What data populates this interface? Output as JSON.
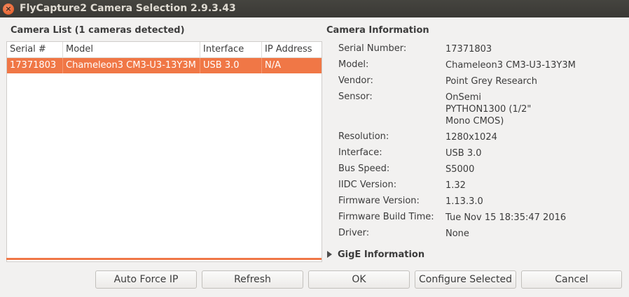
{
  "window": {
    "title": "FlyCapture2 Camera Selection 2.9.3.43",
    "close_glyph": "×"
  },
  "camera_list": {
    "heading": "Camera List   (1 cameras detected)",
    "columns": [
      "Serial #",
      "Model",
      "Interface",
      "IP Address"
    ],
    "rows": [
      [
        "17371803",
        "Chameleon3 CM3-U3-13Y3M",
        "USB 3.0",
        "N/A"
      ]
    ],
    "selection_color": "#f07746"
  },
  "camera_info": {
    "heading": "Camera Information",
    "fields": [
      {
        "label": "Serial Number:",
        "value": "17371803"
      },
      {
        "label": "Model:",
        "value": "Chameleon3 CM3-U3-13Y3M"
      },
      {
        "label": "Vendor:",
        "value": "Point Grey Research"
      },
      {
        "label": "Sensor:",
        "value": "OnSemi\nPYTHON1300 (1/2\"\nMono CMOS)"
      },
      {
        "label": "Resolution:",
        "value": "1280x1024"
      },
      {
        "label": "Interface:",
        "value": "USB 3.0"
      },
      {
        "label": "Bus Speed:",
        "value": "S5000"
      },
      {
        "label": "IIDC Version:",
        "value": "1.32"
      },
      {
        "label": "Firmware Version:",
        "value": "1.13.3.0"
      },
      {
        "label": "Firmware Build Time:",
        "value": "Tue Nov 15 18:35:47 2016"
      },
      {
        "label": "Driver:",
        "value": "None"
      }
    ]
  },
  "gige": {
    "label": "GigE Information",
    "expander_icon": "triangle-right-icon"
  },
  "buttons": {
    "auto_force_ip": "Auto Force IP",
    "refresh": "Refresh",
    "ok": "OK",
    "configure_selected": "Configure Selected",
    "cancel": "Cancel"
  }
}
